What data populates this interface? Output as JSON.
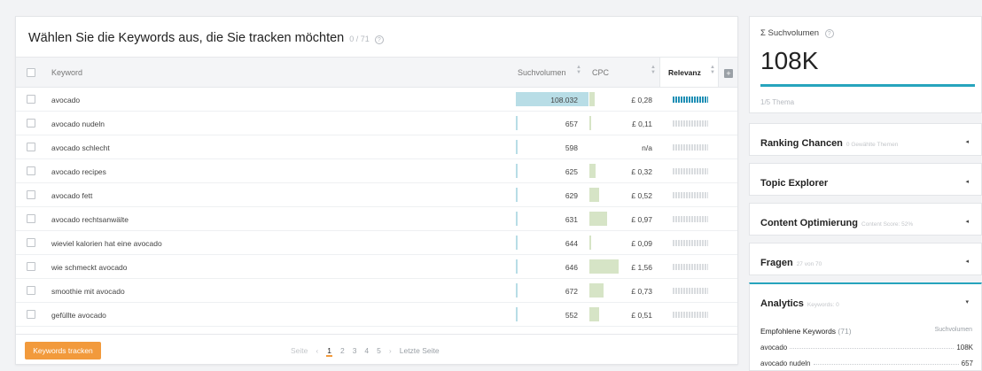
{
  "table": {
    "title": "Wählen Sie die Keywords aus, die Sie tracken möchten",
    "count": "0 / 71",
    "info_glyph": "?",
    "columns": {
      "keyword": "Keyword",
      "volume": "Suchvolumen",
      "cpc": "CPC",
      "relevance": "Relevanz"
    },
    "add_column_glyph": "+",
    "rows": [
      {
        "keyword": "avocado",
        "volume": "108.032",
        "volume_level": 1.0,
        "cpc": "£ 0,28",
        "cpc_level": 0.18,
        "relevance": "high"
      },
      {
        "keyword": "avocado nudeln",
        "volume": "657",
        "volume_level": 0.006,
        "cpc": "£ 0,11",
        "cpc_level": 0.07,
        "relevance": "low"
      },
      {
        "keyword": "avocado schlecht",
        "volume": "598",
        "volume_level": 0.006,
        "cpc": "n/a",
        "cpc_level": 0,
        "relevance": "low"
      },
      {
        "keyword": "avocado recipes",
        "volume": "625",
        "volume_level": 0.006,
        "cpc": "£ 0,32",
        "cpc_level": 0.2,
        "relevance": "low"
      },
      {
        "keyword": "avocado fett",
        "volume": "629",
        "volume_level": 0.006,
        "cpc": "£ 0,52",
        "cpc_level": 0.33,
        "relevance": "low"
      },
      {
        "keyword": "avocado rechtsanwälte",
        "volume": "631",
        "volume_level": 0.006,
        "cpc": "£ 0,97",
        "cpc_level": 0.62,
        "relevance": "low"
      },
      {
        "keyword": "wieviel kalorien hat eine avocado",
        "volume": "644",
        "volume_level": 0.006,
        "cpc": "£ 0,09",
        "cpc_level": 0.06,
        "relevance": "low"
      },
      {
        "keyword": "wie schmeckt avocado",
        "volume": "646",
        "volume_level": 0.006,
        "cpc": "£ 1,56",
        "cpc_level": 1.0,
        "relevance": "low"
      },
      {
        "keyword": "smoothie mit avocado",
        "volume": "672",
        "volume_level": 0.006,
        "cpc": "£ 0,73",
        "cpc_level": 0.47,
        "relevance": "low"
      },
      {
        "keyword": "gefüllte avocado",
        "volume": "552",
        "volume_level": 0.006,
        "cpc": "£ 0,51",
        "cpc_level": 0.33,
        "relevance": "low"
      }
    ],
    "track_button": "Keywords tracken",
    "pagination": {
      "prev": "Seite",
      "prev_arrow": "‹",
      "pages": [
        "1",
        "2",
        "3",
        "4",
        "5"
      ],
      "current": "1",
      "next_arrow": "›",
      "last": "Letzte Seite"
    }
  },
  "volume_panel": {
    "title": "Σ Suchvolumen",
    "value": "108K",
    "subtitle": "1/5 Thema"
  },
  "accordions": [
    {
      "title": "Ranking Chancen",
      "sub": "0 Gewählte Themen",
      "chevron": "◂"
    },
    {
      "title": "Topic Explorer",
      "sub": "",
      "chevron": "◂"
    },
    {
      "title": "Content Optimierung",
      "sub": "Content Score: 52%",
      "chevron": "◂"
    },
    {
      "title": "Fragen",
      "sub": "27 von 70",
      "chevron": "◂"
    }
  ],
  "analytics": {
    "title": "Analytics",
    "sub": "Keywords: 0",
    "chevron": "▾",
    "rec_title": "Empfohlene Keywords",
    "rec_count": "(71)",
    "rec_col": "Suchvolumen",
    "items": [
      {
        "keyword": "avocado",
        "value": "108K"
      },
      {
        "keyword": "avocado nudeln",
        "value": "657"
      }
    ]
  },
  "colors": {
    "accent": "#f29a3c",
    "teal": "#27a4bd",
    "volume_bar": "#b8dde6",
    "cpc_bar": "#d6e4c6",
    "relevance_on": "#1f8fb5"
  }
}
